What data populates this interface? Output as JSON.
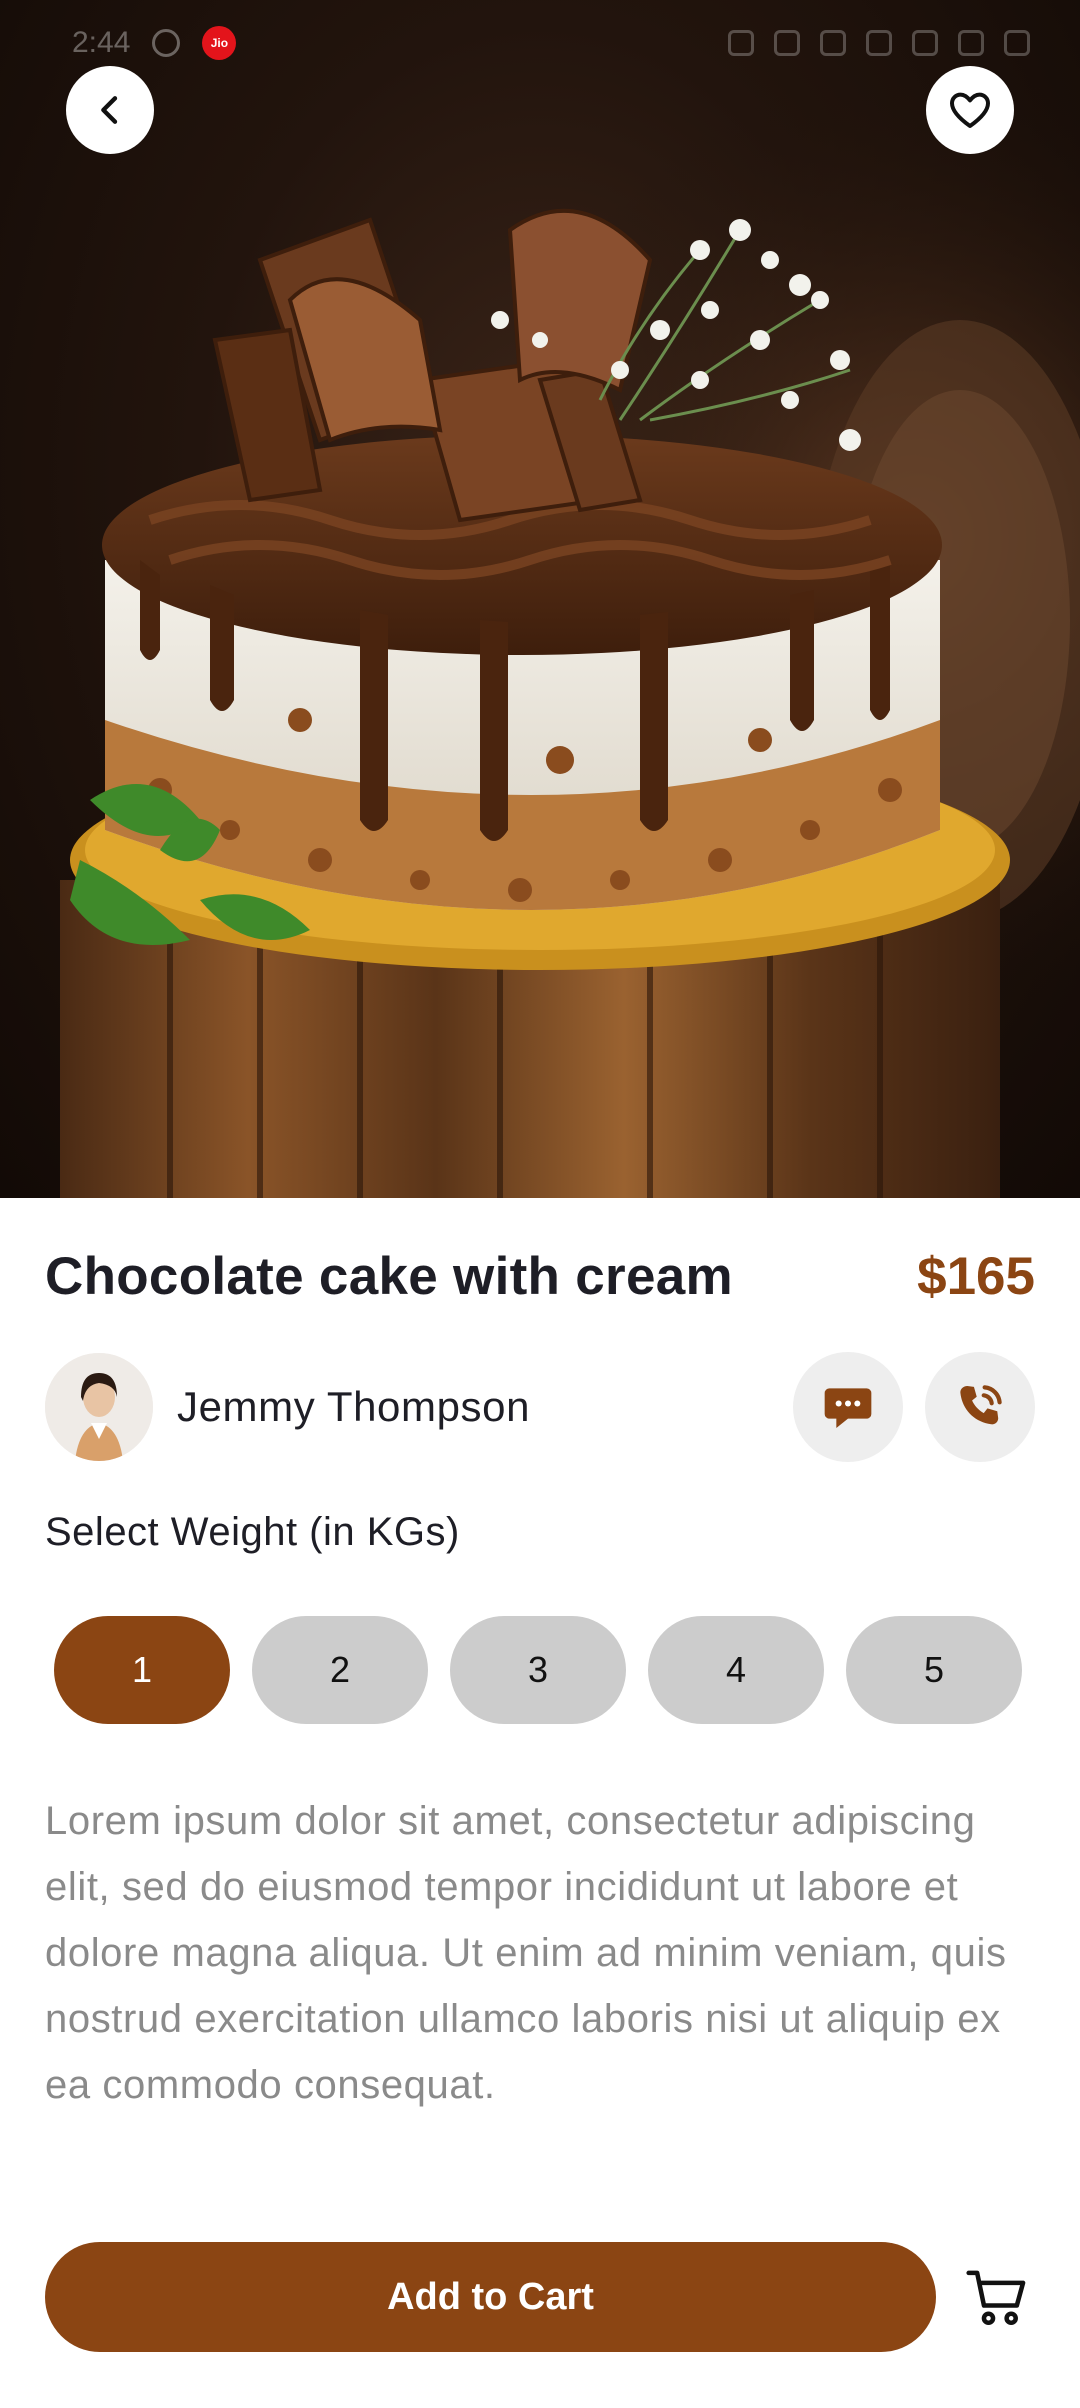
{
  "status_bar": {
    "time": "2:44",
    "carrier_badge": "Jio"
  },
  "hero": {
    "image_icon": "chocolate-cake-photo",
    "back_icon": "chevron-left-icon",
    "favorite_icon": "heart-outline-icon"
  },
  "product": {
    "title": "Chocolate cake with cream",
    "price": "$165"
  },
  "seller": {
    "name": "Jemmy Thompson",
    "chat_icon": "chat-bubble-icon",
    "call_icon": "phone-icon"
  },
  "weight": {
    "label": "Select Weight (in KGs)",
    "options": [
      "1",
      "2",
      "3",
      "4",
      "5"
    ],
    "selected": "1"
  },
  "description": "Lorem ipsum dolor sit amet, consectetur adipiscing elit, sed do eiusmod tempor incididunt ut labore et dolore magna aliqua. Ut enim ad minim veniam, quis nostrud exercitation ullamco laboris nisi ut aliquip ex ea commodo consequat.",
  "cart": {
    "button_label": "Add to Cart",
    "cart_icon": "shopping-cart-icon"
  },
  "colors": {
    "accent": "#8b4513",
    "pill_inactive": "#cccccc",
    "text_primary": "#1e1e26",
    "text_secondary": "#8a8a8a"
  }
}
